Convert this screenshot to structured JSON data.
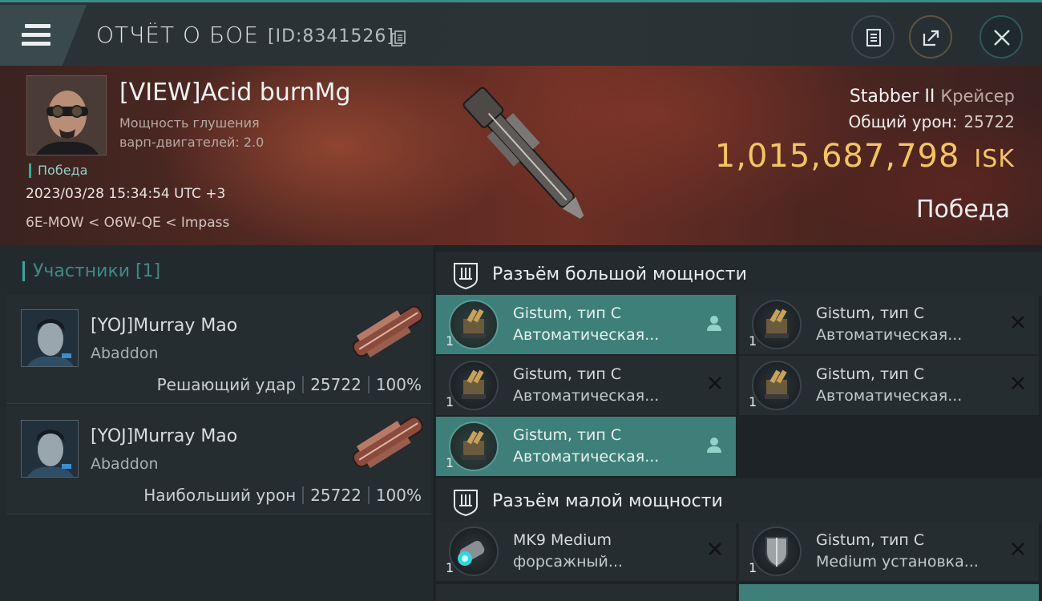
{
  "header": {
    "title": "ОТЧЁТ О БОЕ",
    "report_id": "[ID:8341526]",
    "icons": [
      "menu-icon",
      "copy-icon",
      "clipboard-icon",
      "export-icon",
      "close-icon"
    ]
  },
  "victim": {
    "name": "[VIEW]Acid burnMg",
    "attr_line1": "Мощность глушения",
    "attr_line2": "варп-двигателей: 2.0",
    "result_tag": "Победа",
    "datetime": "2023/03/28 15:34:54 UTC +3",
    "location": "6E-MOW < O6W-QE < Impass",
    "ship_name": "Stabber II",
    "ship_class": "Крейсер",
    "total_damage_label": "Общий урон:",
    "total_damage": "25722",
    "isk_value": "1,015,687,798",
    "isk_unit": "ISK",
    "outcome": "Победа"
  },
  "participants": {
    "header": "Участники [1]",
    "rows": [
      {
        "name": "[YOJ]Murray Mao",
        "ship": "Abaddon",
        "role": "Решающий удар",
        "damage": "25722",
        "percent": "100%"
      },
      {
        "name": "[YOJ]Murray Mao",
        "ship": "Abaddon",
        "role": "Наибольший урон",
        "damage": "25722",
        "percent": "100%"
      }
    ]
  },
  "slots": {
    "high": {
      "title": "Разъём большой мощности",
      "items": [
        {
          "qty": "1",
          "line1": "Gistum, тип C",
          "line2": "Автоматическая...",
          "state": "dropped"
        },
        {
          "qty": "1",
          "line1": "Gistum, тип C",
          "line2": "Автоматическая...",
          "state": "destroyed"
        },
        {
          "qty": "1",
          "line1": "Gistum, тип C",
          "line2": "Автоматическая...",
          "state": "destroyed"
        },
        {
          "qty": "1",
          "line1": "Gistum, тип C",
          "line2": "Автоматическая...",
          "state": "destroyed"
        },
        {
          "qty": "1",
          "line1": "Gistum, тип C",
          "line2": "Автоматическая...",
          "state": "dropped"
        }
      ]
    },
    "low": {
      "title": "Разъём малой мощности",
      "items": [
        {
          "qty": "1",
          "line1": "MK9 Medium",
          "line2": "форсажный...",
          "state": "destroyed"
        },
        {
          "qty": "1",
          "line1": "Gistum, тип C",
          "line2": "Medium установка...",
          "state": "destroyed"
        }
      ]
    }
  },
  "colors": {
    "accent": "#3aa99a",
    "isk": "#f3c563",
    "active_slot": "#3e7f79"
  }
}
